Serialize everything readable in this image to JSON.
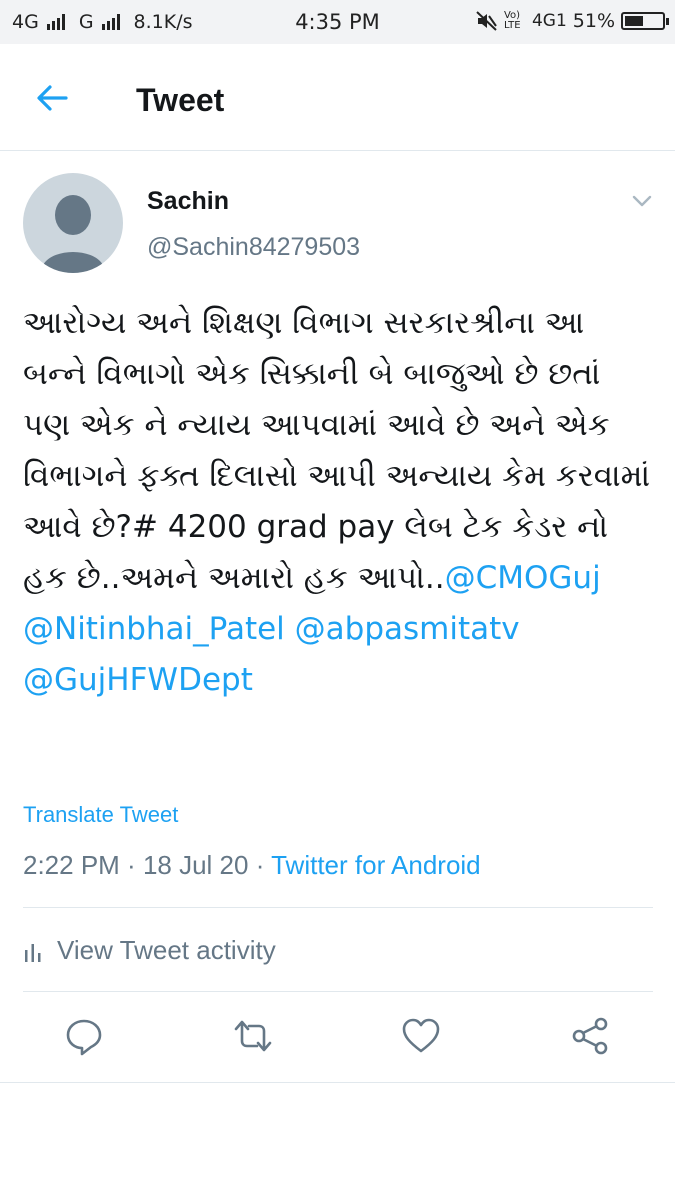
{
  "status_bar": {
    "net1": "4G",
    "net2": "G",
    "speed": "8.1K/s",
    "time": "4:35 PM",
    "volte": "Vo) LTE",
    "net3": "4G1",
    "battery": "51%",
    "battery_level": 0.51
  },
  "header": {
    "title": "Tweet"
  },
  "tweet": {
    "name": "Sachin",
    "handle": "@Sachin84279503",
    "text_part1": "આરોગ્ય અને શિક્ષણ વિભાગ સરકારશ્રીના આ બન્ને વિભાગો એક સિક્કાની બે બાજુઓ છે છતાં પણ એક ને ન્યાય આપવામાં આવે છે અને એક વિભાગને ફક્ત દિલાસો આપી અન્યાય કેમ કરવામાં આવે છે?# 4200 grad pay લેબ ટેક કેડર નો હક છે..અમને અમારો હક આપો..",
    "mention1": "@CMOGuj",
    "mention2": "@Nitinbhai_Patel",
    "mention3": "@abpasmitatv",
    "mention4": "@GujHFWDept",
    "translate": "Translate Tweet",
    "time": "2:22 PM",
    "sep1": " · ",
    "date": "18 Jul 20",
    "sep2": " · ",
    "source": "Twitter for Android",
    "activity": "View Tweet activity"
  },
  "colors": {
    "accent": "#1da1f2",
    "secondary": "#657786",
    "divider": "#e1e8ed",
    "statusbar": "#f2f3f5"
  },
  "icons": [
    "back-arrow-icon",
    "chevron-down-icon",
    "reply-icon",
    "retweet-icon",
    "like-icon",
    "share-icon",
    "activity-bars-icon"
  ]
}
